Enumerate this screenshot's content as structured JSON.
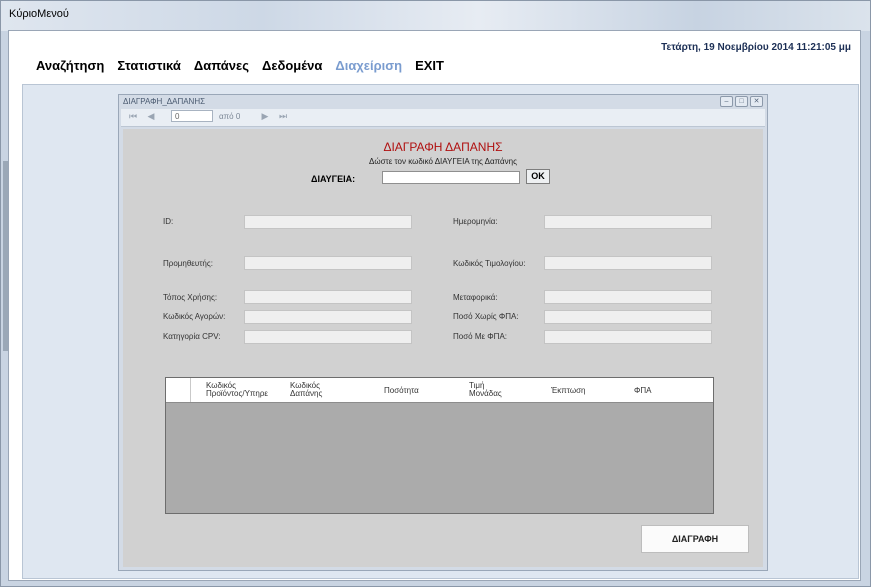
{
  "window": {
    "title": "ΚύριοΜενού"
  },
  "datetime": "Τετάρτη, 19 Νοεμβρίου 2014 11:21:05 μμ",
  "menu": [
    {
      "label": "Αναζήτηση",
      "enabled": true
    },
    {
      "label": "Στατιστικά",
      "enabled": true
    },
    {
      "label": "Δαπάνες",
      "enabled": true
    },
    {
      "label": "Δεδομένα",
      "enabled": true
    },
    {
      "label": "Διαχείριση",
      "enabled": false
    },
    {
      "label": "EXIT",
      "enabled": true
    }
  ],
  "child_window": {
    "title": "ΔΙΑΓΡΑΦΗ_ΔΑΠΑΝΗΣ",
    "controls": {
      "minimize": "minimize-icon",
      "maximize": "maximize-icon",
      "close": "close-icon"
    }
  },
  "navigator": {
    "first": "⏮",
    "prev": "◀",
    "position": "0",
    "of_label": "από 0",
    "next": "▶",
    "last": "⏭"
  },
  "form": {
    "title": "ΔΙΑΓΡΑΦΗ ΔΑΠΑΝΗΣ",
    "title_color": "#b01010",
    "subtitle": "Δώστε τον κωδικό ΔΙΑΥΓΕΙΑ της Δαπάνης",
    "diavgeia_label": "ΔΙΑΥΓΕΙΑ:",
    "diavgeia_value": "",
    "ok_label": "OK",
    "fields": {
      "id": {
        "label": "ID:",
        "value": ""
      },
      "date": {
        "label": "Ημερομηνία:",
        "value": ""
      },
      "supplier": {
        "label": "Προμηθευτής:",
        "value": ""
      },
      "invoice_code": {
        "label": "Κωδικός Τιμολογίου:",
        "value": ""
      },
      "place_of_use": {
        "label": "Τόπος Χρήσης:",
        "value": ""
      },
      "shipping": {
        "label": "Μεταφορικά:",
        "value": ""
      },
      "purchase_code": {
        "label": "Κωδικός Αγορών:",
        "value": ""
      },
      "amount_no_vat": {
        "label": "Ποσό Χωρίς ΦΠΑ:",
        "value": ""
      },
      "cpv_category": {
        "label": "Κατηγορία CPV:",
        "value": ""
      },
      "amount_with_vat": {
        "label": "Ποσό Με ΦΠΑ:",
        "value": ""
      }
    },
    "grid": {
      "columns": [
        {
          "line1": "Κωδικός",
          "line2": "Προϊόντος/Υπηρε"
        },
        {
          "line1": "Κωδικός",
          "line2": "Δαπάνης"
        },
        {
          "line1": "Ποσότητα",
          "line2": ""
        },
        {
          "line1": "Τιμή",
          "line2": "Μονάδας"
        },
        {
          "line1": "Έκπτωση",
          "line2": ""
        },
        {
          "line1": "ΦΠΑ",
          "line2": ""
        }
      ],
      "rows": []
    },
    "delete_label": "ΔΙΑΓΡΑΦΗ"
  }
}
